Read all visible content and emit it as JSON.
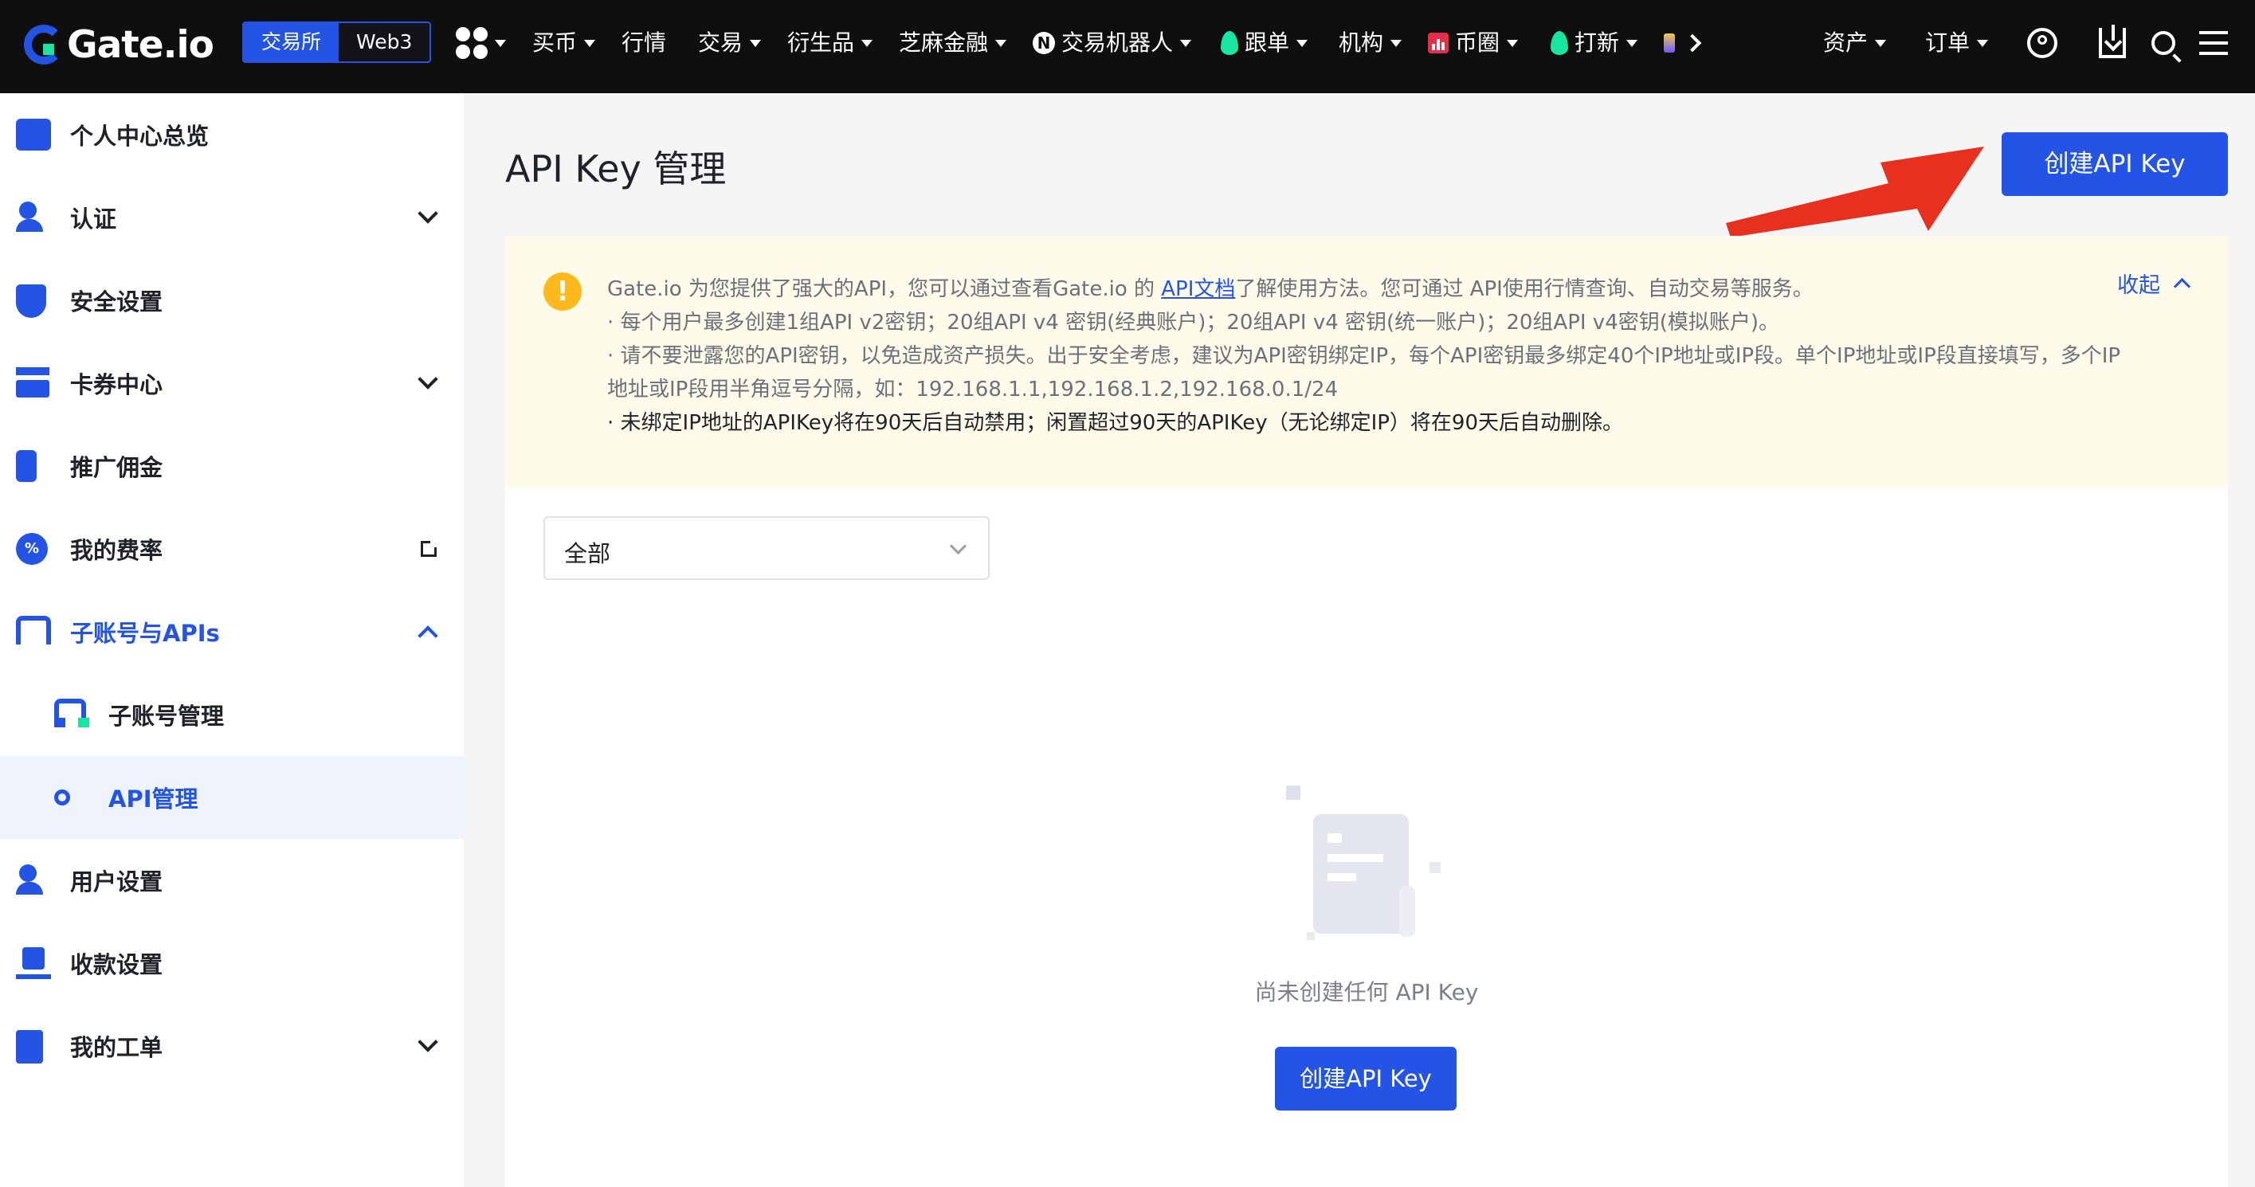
{
  "topnav": {
    "logo": "Gate.io",
    "exchange_tabs": [
      {
        "label": "交易所"
      },
      {
        "label": "Web3"
      }
    ],
    "items": [
      {
        "label": "买币"
      },
      {
        "label": "行情"
      },
      {
        "label": "交易"
      },
      {
        "label": "衍生品"
      },
      {
        "label": "芝麻金融"
      },
      {
        "label": "交易机器人"
      },
      {
        "label": "跟单"
      },
      {
        "label": "机构"
      },
      {
        "label": "币圈"
      },
      {
        "label": "打新"
      }
    ],
    "right_items": [
      {
        "label": "资产"
      },
      {
        "label": "订单"
      }
    ]
  },
  "sidebar": {
    "items": [
      {
        "label": "个人中心总览",
        "icon": "profile-card-icon"
      },
      {
        "label": "认证",
        "icon": "verify-user-icon"
      },
      {
        "label": "安全设置",
        "icon": "shield-icon"
      },
      {
        "label": "卡券中心",
        "icon": "coupon-icon"
      },
      {
        "label": "推广佣金",
        "icon": "referral-icon"
      },
      {
        "label": "我的费率",
        "icon": "fee-rate-icon"
      },
      {
        "label": "子账号与APIs",
        "icon": "subaccount-icon"
      },
      {
        "label": "子账号管理",
        "icon": "subaccount-manage-icon"
      },
      {
        "label": "API管理",
        "icon": "api-key-icon"
      },
      {
        "label": "用户设置",
        "icon": "user-settings-icon"
      },
      {
        "label": "收款设置",
        "icon": "payment-settings-icon"
      },
      {
        "label": "我的工单",
        "icon": "ticket-icon"
      }
    ]
  },
  "main": {
    "title": "API Key 管理",
    "create_button": "创建API Key",
    "notice": {
      "line1_prefix": "Gate.io 为您提供了强大的API，您可以通过查看Gate.io 的 ",
      "line1_link": "API文档",
      "line1_suffix": "了解使用方法。您可通过 API使用行情查询、自动交易等服务。",
      "line2": "· 每个用户最多创建1组API v2密钥；20组API v4 密钥(经典账户)；20组API v4 密钥(统一账户)；20组API v4密钥(模拟账户)。",
      "line3": "· 请不要泄露您的API密钥，以免造成资产损失。出于安全考虑，建议为API密钥绑定IP，每个API密钥最多绑定40个IP地址或IP段。单个IP地址或IP段直接填写，多个IP地址或IP段用半角逗号分隔，如：192.168.1.1,192.168.1.2,192.168.0.1/24",
      "line4": "· 未绑定IP地址的APIKey将在90天后自动禁用；闲置超过90天的APIKey（无论绑定IP）将在90天后自动删除。",
      "collapse": "收起"
    },
    "filter": {
      "selected": "全部"
    },
    "empty_text": "尚未创建任何 API Key",
    "empty_button": "创建API Key"
  },
  "colors": {
    "brand": "#2354e6",
    "notice_bg": "#fffbea",
    "warning": "#ffb81c",
    "arrow": "#e8301e"
  }
}
